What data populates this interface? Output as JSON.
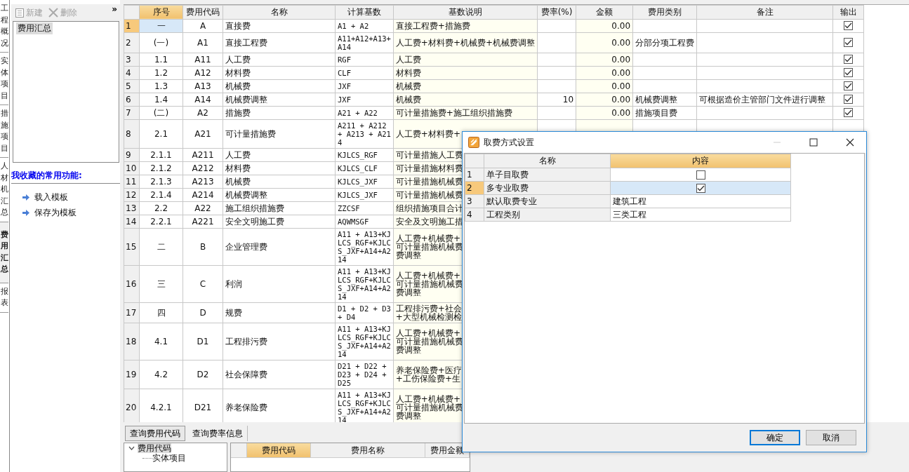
{
  "side_tabs": [
    {
      "label": "工程概况",
      "selected": false
    },
    {
      "label": "实体项目",
      "selected": false
    },
    {
      "label": "措施项目",
      "selected": false
    },
    {
      "label": "人材机汇总",
      "selected": false
    },
    {
      "label": "费用汇总",
      "selected": true
    },
    {
      "label": "报表",
      "selected": false
    }
  ],
  "sidebar": {
    "toolbar": [
      {
        "kind": "new",
        "label": "新建",
        "disabled": true
      },
      {
        "kind": "delete",
        "label": "删除",
        "disabled": true
      }
    ],
    "collapse": "»",
    "list": [
      {
        "label": "费用汇总",
        "selected": true
      }
    ],
    "favorites_title": "我收藏的常用功能:",
    "favorites": [
      "载入模板",
      "保存为模板"
    ]
  },
  "table": {
    "columns": [
      {
        "label": "序号",
        "sorted": true
      },
      {
        "label": "费用代码",
        "sorted": false
      },
      {
        "label": "名称",
        "sorted": false
      },
      {
        "label": "计算基数",
        "sorted": false
      },
      {
        "label": "基数说明",
        "sorted": false
      },
      {
        "label": "费率(%)",
        "sorted": false
      },
      {
        "label": "金额",
        "sorted": false
      },
      {
        "label": "费用类别",
        "sorted": false
      },
      {
        "label": "备注",
        "sorted": false
      },
      {
        "label": "输出",
        "sorted": false
      }
    ],
    "rows": [
      {
        "number": "1",
        "selected": true,
        "seq": "一",
        "code": "A",
        "name": "直接费",
        "calc": [
          "A1 + A2"
        ],
        "desc": [
          "直接工程费+措施费"
        ],
        "amount": "0.00",
        "output": true
      },
      {
        "number": "2",
        "selected": false,
        "seq": "(一)",
        "code": "A1",
        "name": "直接工程费",
        "calc": [
          "A11+A12+A13+",
          "A14"
        ],
        "desc": [
          "人工费+材料费+机械费+机械费调整"
        ],
        "amount": "0.00",
        "category": "分部分项工程费",
        "output": true
      },
      {
        "number": "3",
        "selected": false,
        "seq": "1.1",
        "code": "A11",
        "name": "人工费",
        "calc": [
          "RGF"
        ],
        "desc": [
          "人工费"
        ],
        "amount": "0.00",
        "output": true
      },
      {
        "number": "4",
        "selected": false,
        "seq": "1.2",
        "code": "A12",
        "name": "材料费",
        "calc": [
          "CLF"
        ],
        "desc": [
          "材料费"
        ],
        "amount": "0.00",
        "output": true
      },
      {
        "number": "5",
        "selected": false,
        "seq": "1.3",
        "code": "A13",
        "name": "机械费",
        "calc": [
          "JXF"
        ],
        "desc": [
          "机械费"
        ],
        "amount": "0.00",
        "output": true
      },
      {
        "number": "6",
        "selected": false,
        "seq": "1.4",
        "code": "A14",
        "name": "机械费调整",
        "calc": [
          "JXF"
        ],
        "desc": [
          "机械费"
        ],
        "rate": "10",
        "amount": "0.00",
        "category": "机械费调整",
        "note": "可根据造价主管部门文件进行调整",
        "output": true
      },
      {
        "number": "7",
        "selected": false,
        "seq": "(二)",
        "code": "A2",
        "name": "措施费",
        "calc": [
          "A21 + A22"
        ],
        "desc": [
          "可计量措施费+施工组织措施费"
        ],
        "amount": "0.00",
        "category": "措施项目费",
        "output": true
      },
      {
        "number": "8",
        "selected": false,
        "seq": "2.1",
        "code": "A21",
        "name": "可计量措施费",
        "calc": [
          "A211 + A212",
          "+ A213 + A21",
          "4"
        ],
        "desc": [
          "人工费+材料费+"
        ]
      },
      {
        "number": "9",
        "selected": false,
        "seq": "2.1.1",
        "code": "A211",
        "name": "人工费",
        "calc": [
          "KJLCS_RGF"
        ],
        "desc": [
          "可计量措施人工费"
        ]
      },
      {
        "number": "10",
        "selected": false,
        "seq": "2.1.2",
        "code": "A212",
        "name": "材料费",
        "calc": [
          "KJLCS_CLF"
        ],
        "desc": [
          "可计量措施材料费"
        ]
      },
      {
        "number": "11",
        "selected": false,
        "seq": "2.1.3",
        "code": "A213",
        "name": "机械费",
        "calc": [
          "KJLCS_JXF"
        ],
        "desc": [
          "可计量措施机械费"
        ]
      },
      {
        "number": "12",
        "selected": false,
        "seq": "2.1.4",
        "code": "A214",
        "name": "机械费调整",
        "calc": [
          "KJLCS_JXF"
        ],
        "desc": [
          "可计量措施机械费"
        ]
      },
      {
        "number": "13",
        "selected": false,
        "seq": "2.2",
        "code": "A22",
        "name": "施工组织措施费",
        "calc": [
          "ZZCSF"
        ],
        "desc": [
          "组织措施项目合计"
        ]
      },
      {
        "number": "14",
        "selected": false,
        "seq": "2.2.1",
        "code": "A221",
        "name": "安全文明施工费",
        "calc": [
          "AQWMSGF"
        ],
        "desc": [
          "安全及文明施工措"
        ]
      },
      {
        "number": "15",
        "selected": false,
        "seq": "二",
        "code": "B",
        "name": "企业管理费",
        "calc": [
          "A11 + A13+KJ",
          "LCS_RGF+KJLC",
          "S_JXF+A14+A2",
          "14"
        ],
        "desc": [
          "人工费+机械费+",
          "可计量措施机械费",
          "费调整"
        ]
      },
      {
        "number": "16",
        "selected": false,
        "seq": "三",
        "code": "C",
        "name": "利润",
        "calc": [
          "A11 + A13+KJ",
          "LCS_RGF+KJLC",
          "S_JXF+A14+A2",
          "14"
        ],
        "desc": [
          "人工费+机械费+",
          "可计量措施机械费",
          "费调整"
        ]
      },
      {
        "number": "17",
        "selected": false,
        "seq": "四",
        "code": "D",
        "name": "规费",
        "calc": [
          "D1 + D2 + D3",
          "+ D4"
        ],
        "desc": [
          "工程排污费+社会",
          "+大型机械检测检"
        ]
      },
      {
        "number": "18",
        "selected": false,
        "seq": "4.1",
        "code": "D1",
        "name": "工程排污费",
        "calc": [
          "A11 + A13+KJ",
          "LCS_RGF+KJLC",
          "S_JXF+A14+A2",
          "14"
        ],
        "desc": [
          "人工费+机械费+",
          "可计量措施机械费",
          "费调整"
        ]
      },
      {
        "number": "19",
        "selected": false,
        "seq": "4.2",
        "code": "D2",
        "name": "社会保障费",
        "calc": [
          "D21 + D22 +",
          "D23 + D24 +",
          "D25"
        ],
        "desc": [
          "养老保险费+医疗",
          "+工伤保险费+生"
        ]
      },
      {
        "number": "20",
        "selected": false,
        "seq": "4.2.1",
        "code": "D21",
        "name": "养老保险费",
        "calc": [
          "A11 + A13+KJ",
          "LCS_RGF+KJLC",
          "S_JXF+A14+A2",
          "14"
        ],
        "desc": [
          "人工费+机械费+",
          "可计量措施机械费",
          "费调整"
        ]
      }
    ]
  },
  "bottom_panel": {
    "tabs": [
      {
        "label": "查询费用代码",
        "selected": true
      },
      {
        "label": "查询费率信息",
        "selected": false
      }
    ],
    "tree": [
      {
        "label": "费用代码",
        "expanded": true,
        "selected": true,
        "children": [
          {
            "label": "实体项目"
          }
        ]
      }
    ],
    "columns": [
      {
        "label": "费用代码",
        "sorted": true
      },
      {
        "label": "费用名称",
        "sorted": false
      },
      {
        "label": "费用金额",
        "sorted": false
      }
    ]
  },
  "dialog": {
    "title": "取费方式设置",
    "columns": [
      {
        "label": "名称",
        "sorted": false
      },
      {
        "label": "内容",
        "sorted": true
      }
    ],
    "rows": [
      {
        "number": "1",
        "name": "单子目取费",
        "kind": "checkbox",
        "checked": false,
        "selected": false
      },
      {
        "number": "2",
        "name": "多专业取费",
        "kind": "checkbox",
        "checked": true,
        "selected": true
      },
      {
        "number": "3",
        "name": "默认取费专业",
        "kind": "text",
        "value": "建筑工程",
        "selected": false
      },
      {
        "number": "4",
        "name": "工程类别",
        "kind": "text",
        "value": "三类工程",
        "selected": false
      }
    ],
    "buttons": [
      {
        "label": "确定",
        "default": true
      },
      {
        "label": "取消",
        "default": false
      }
    ]
  }
}
